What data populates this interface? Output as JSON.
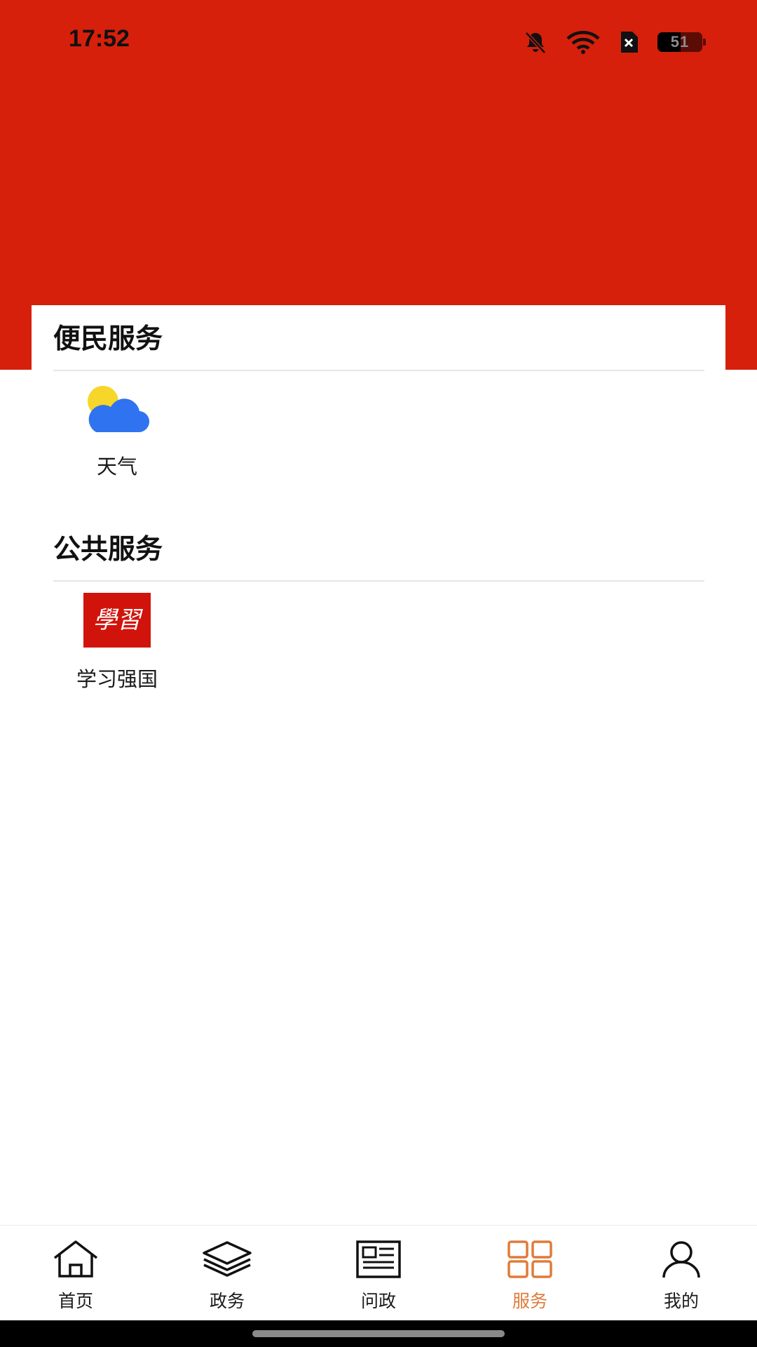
{
  "status_bar": {
    "time": "17:52",
    "battery": "51",
    "battery_level": 0.51,
    "icons": [
      "bell-muted-icon",
      "wifi-icon",
      "sim-error-icon",
      "battery-icon"
    ]
  },
  "colors": {
    "header_bg": "#d6200b",
    "tab_active": "#e07b39",
    "weather_cloud": "#2f73f0",
    "weather_sun": "#f7d62c",
    "xuexi_bg": "#d1140b"
  },
  "sections": [
    {
      "title": "便民服务",
      "items": [
        {
          "label": "天气",
          "icon": "weather-icon"
        }
      ]
    },
    {
      "title": "公共服务",
      "items": [
        {
          "label": "学习强国",
          "icon": "xuexi-qiangguo-icon",
          "icon_text": "學習"
        }
      ]
    }
  ],
  "tabbar": {
    "items": [
      {
        "label": "首页",
        "icon": "home-icon",
        "active": false
      },
      {
        "label": "政务",
        "icon": "layers-icon",
        "active": false
      },
      {
        "label": "问政",
        "icon": "newspaper-icon",
        "active": false
      },
      {
        "label": "服务",
        "icon": "grid-icon",
        "active": true
      },
      {
        "label": "我的",
        "icon": "person-icon",
        "active": false
      }
    ]
  }
}
